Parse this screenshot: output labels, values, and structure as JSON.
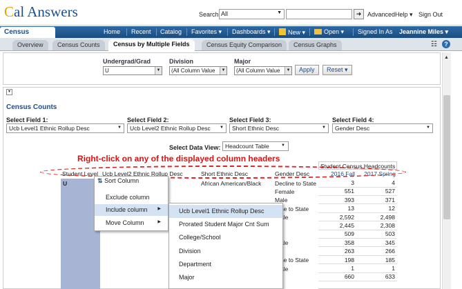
{
  "app": {
    "logo_a": "C",
    "logo_b": "al Answers"
  },
  "search": {
    "label": "Search",
    "scope": "All"
  },
  "toplinks": {
    "advanced": "Advanced",
    "help": "Help ▾",
    "signout": "Sign Out"
  },
  "nav": {
    "title": "Census",
    "items": [
      "Home",
      "Recent",
      "Catalog",
      "Favorites ▾",
      "Dashboards ▾",
      "New ▾",
      "Open ▾"
    ],
    "signed_in_label": "Signed In As",
    "user": "Jeannine Miles ▾"
  },
  "tabs": [
    "Overview",
    "Census Counts",
    "Census by Multiple Fields",
    "Census Equity Comparison",
    "Census Graphs"
  ],
  "prompts": {
    "undergrad_label": "Undergrad/Grad",
    "undergrad_value": "U",
    "division_label": "Division",
    "division_value": "(All Column Value",
    "major_label": "Major",
    "major_value": "(All Column Value",
    "apply": "Apply",
    "reset": "Reset ▾"
  },
  "section": {
    "title": "Census Counts"
  },
  "fields": [
    {
      "label": "Select Field 1:",
      "value": "Ucb Level1 Ethnic Rollup Desc"
    },
    {
      "label": "Select Field 2:",
      "value": "Ucb Level2 Ethnic Rollup Desc"
    },
    {
      "label": "Select Field 3:",
      "value": "Short Ethnic Desc"
    },
    {
      "label": "Select Field 4:",
      "value": "Gender Desc"
    }
  ],
  "data_view": {
    "label": "Select Data View:",
    "value": "Headcount Table"
  },
  "annotation": "Right-click on any of the displayed column headers",
  "table": {
    "group_header": "Student Census Headcounts",
    "col_headers": [
      "Student Level",
      "Ucb Level2 Ethnic Rollup Desc",
      "Short Ethnic Desc",
      "Gender Desc",
      "2016 Fall",
      "2017 Spring"
    ],
    "student_level": "U",
    "ethnic": "African American/Black",
    "genders": [
      "Decline to State",
      "Female",
      "Male",
      "ne to State",
      "ale",
      "",
      "",
      "ale",
      "",
      "ne to State",
      "ale"
    ],
    "fall": [
      "3",
      "551",
      "393",
      "13",
      "2,592",
      "2,445",
      "509",
      "358",
      "263",
      "198",
      "1",
      "660"
    ],
    "spring": [
      "4",
      "527",
      "371",
      "12",
      "2,498",
      "2,308",
      "503",
      "345",
      "266",
      "185",
      "1",
      "633"
    ]
  },
  "context_menu": {
    "sort": "Sort Column",
    "items": [
      "Exclude column",
      "Include column",
      "Move Column"
    ]
  },
  "submenu": [
    "Ucb Level1 Ethnic Rollup Desc",
    "Prorated Student Major Cnt Sum",
    "College/School",
    "Division",
    "Department",
    "Major"
  ]
}
